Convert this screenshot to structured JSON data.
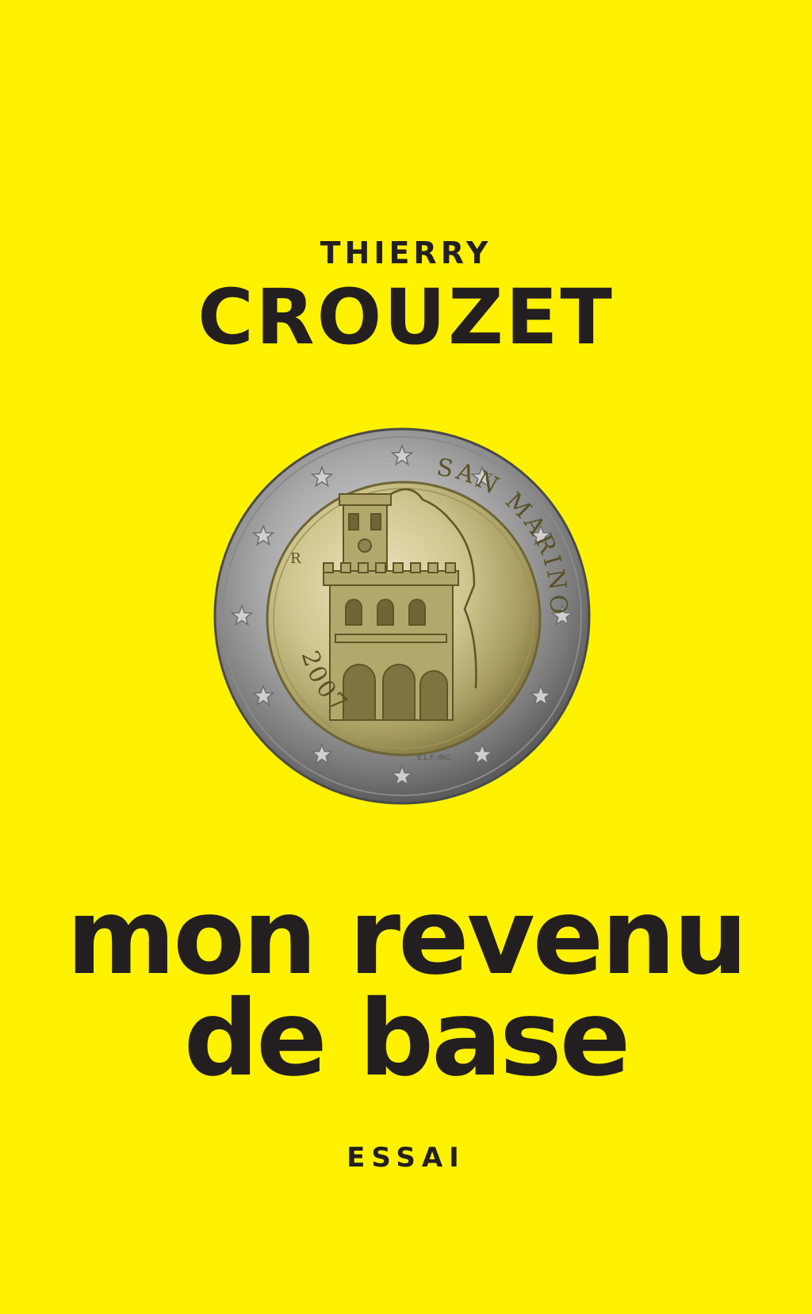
{
  "author": {
    "first_name": "THIERRY",
    "last_name": "CROUZET"
  },
  "coin": {
    "inscription_country": "SAN MARINO",
    "inscription_year": "2007",
    "mint_mark": "R",
    "engraver": "E.L.F. INC."
  },
  "title": {
    "line1": "mon revenu",
    "line2": "de base"
  },
  "genre": "ESSAI",
  "colors": {
    "background": "#fff200",
    "text": "#231f20",
    "coin_ring": "#9a9a9a",
    "coin_center": "#c9c08a"
  }
}
